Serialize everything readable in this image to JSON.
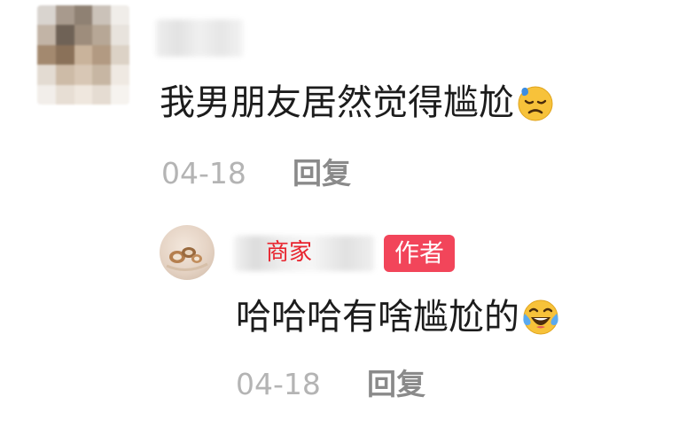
{
  "comment": {
    "text": "我男朋友居然觉得尴尬",
    "emoji": "sweat-sad-emoji",
    "date": "04-18",
    "reply_label": "回复"
  },
  "reply": {
    "username_tag": "商家",
    "badge": "作者",
    "text": "哈哈哈有啥尴尬的",
    "emoji": "rolling-laughing-emoji",
    "date": "04-18",
    "reply_label": "回复"
  },
  "colors": {
    "text": "#1c1c1c",
    "date": "#b4b4b4",
    "reply_action": "#8a8a8a",
    "merchant_tag": "#e8232d",
    "author_badge_bg": "#f2455a"
  }
}
